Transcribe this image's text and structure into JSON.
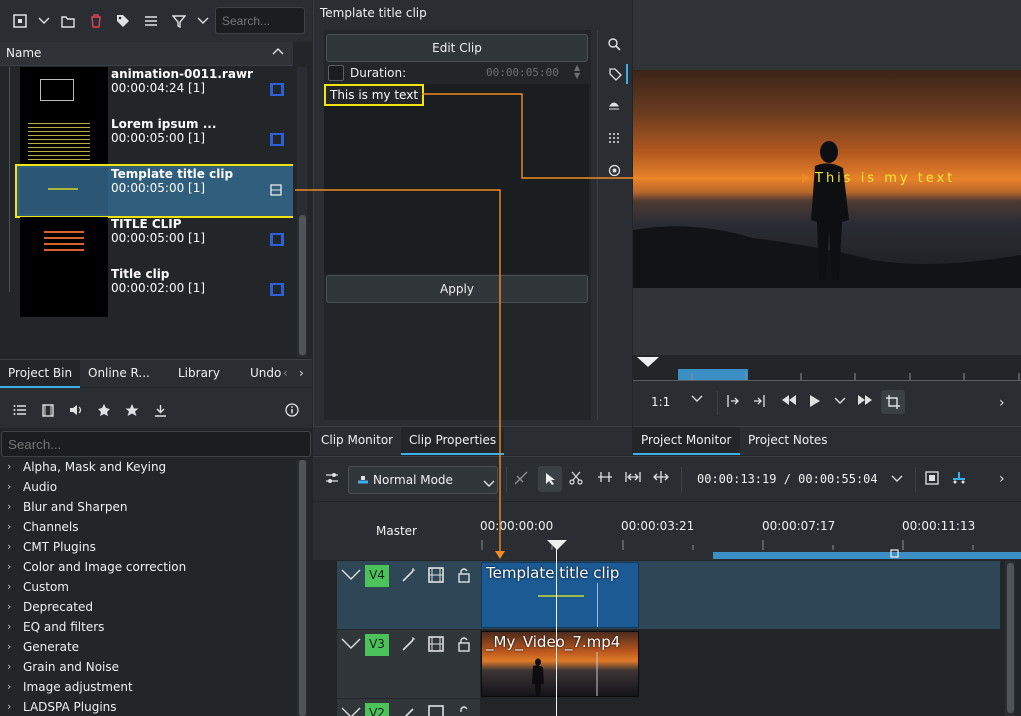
{
  "bin": {
    "search_placeholder": "Search...",
    "header_name": "Name",
    "clips": [
      {
        "name": "animation-0011.rawr",
        "duration": "00:00:04:24 [1]"
      },
      {
        "name": "Lorem ipsum ...",
        "duration": "00:00:05:00 [1]"
      },
      {
        "name": "Template title clip",
        "duration": "00:00:05:00 [1]"
      },
      {
        "name": "TITLE CLIP",
        "duration": "00:00:05:00 [1]"
      },
      {
        "name": "Title clip",
        "duration": "00:00:02:00 [1]"
      }
    ],
    "tabs": [
      "Project Bin",
      "Online R...",
      "Library",
      "Undo"
    ]
  },
  "effects": {
    "search_placeholder": "Search...",
    "categories": [
      "Alpha, Mask and Keying",
      "Audio",
      "Blur and Sharpen",
      "Channels",
      "CMT Plugins",
      "Color and Image correction",
      "Custom",
      "Deprecated",
      "EQ and filters",
      "Generate",
      "Grain and Noise",
      "Image adjustment",
      "LADSPA Plugins"
    ]
  },
  "props": {
    "title": "Template title clip",
    "edit_clip": "Edit Clip",
    "duration_label": "Duration:",
    "duration_value": "00:00:05:00",
    "text_value": "This is my text",
    "apply": "Apply"
  },
  "left_monitor_tabs": [
    "Clip Monitor",
    "Clip Properties"
  ],
  "right_monitor_tabs": [
    "Project Monitor",
    "Project Notes"
  ],
  "monitor": {
    "overlay_text": "This is my text",
    "zoom": "1:1"
  },
  "timeline": {
    "mode": "Normal Mode",
    "timecode": "00:00:13:19 / 00:00:55:04",
    "master": "Master",
    "ruler": [
      "00:00:00:00",
      "00:00:03:21",
      "00:00:07:17",
      "00:00:11:13"
    ],
    "tracks": [
      {
        "id": "V4",
        "clip": "Template title clip"
      },
      {
        "id": "V3",
        "clip": "_My_Video_7.mp4"
      },
      {
        "id": "V2",
        "clip": ""
      }
    ]
  },
  "colors": {
    "accent": "#3daee9",
    "selection": "#f0e312",
    "track_badge": "#4cc25a",
    "connector": "#f08a24"
  }
}
